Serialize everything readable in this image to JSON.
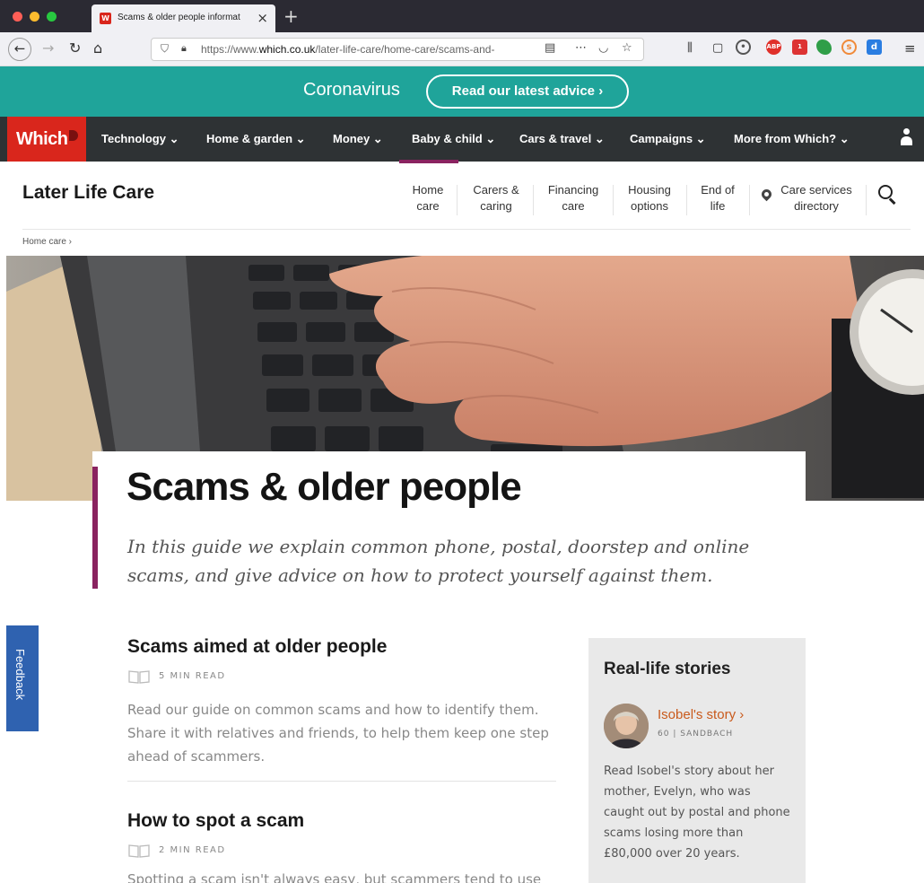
{
  "browser": {
    "tab_title": "Scams & older people informat",
    "tab_favicon": "W",
    "url_prefix": "https://www.",
    "url_domain": "which.co.uk",
    "url_path": "/later-life-care/home-care/scams-and-"
  },
  "banner": {
    "label": "Coronavirus",
    "button": "Read our latest advice ›"
  },
  "mainnav": {
    "logo": "Which",
    "items": [
      "Technology ⌄",
      "Home & garden ⌄",
      "Money ⌄",
      "Baby & child ⌄",
      "Cars & travel ⌄",
      "Campaigns ⌄",
      "More from Which? ⌄"
    ],
    "active_index": 3
  },
  "subnav": {
    "site_title": "Later Life Care",
    "items": [
      {
        "line1": "Home",
        "line2": "care"
      },
      {
        "line1": "Carers &",
        "line2": "caring"
      },
      {
        "line1": "Financing",
        "line2": "care"
      },
      {
        "line1": "Housing",
        "line2": "options"
      },
      {
        "line1": "End of",
        "line2": "life"
      },
      {
        "line1": "Care services",
        "line2": "directory"
      }
    ]
  },
  "breadcrumb": "Home care ›",
  "article": {
    "title": "Scams & older people",
    "standfirst": "In this guide we explain common phone, postal, doorstep and online scams, and give advice on how to protect yourself against them."
  },
  "feedback": "Feedback",
  "guides": [
    {
      "title": "Scams aimed at older people",
      "read_time": "5 MIN READ",
      "description": "Read our guide on common scams and how to identify them. Share it with relatives and friends, to help them keep one step ahead of scammers."
    },
    {
      "title": "How to spot a scam",
      "read_time": "2 MIN READ",
      "description": "Spotting a scam isn't always easy, but scammers tend to use"
    }
  ],
  "sidebar": {
    "title": "Real-life stories",
    "story_link": "Isobel's story ›",
    "story_meta": "60 | SANDBACH",
    "story_text": "Read Isobel's story about her mother, Evelyn, who was caught out by postal and phone scams losing more than £80,000 over 20 years."
  },
  "colors": {
    "banner": "#1fa49a",
    "nav": "#2e3234",
    "brand_red": "#d9261c",
    "accent_purple": "#8a2360",
    "link_orange": "#c95a1c",
    "feedback_blue": "#2f62b0"
  }
}
